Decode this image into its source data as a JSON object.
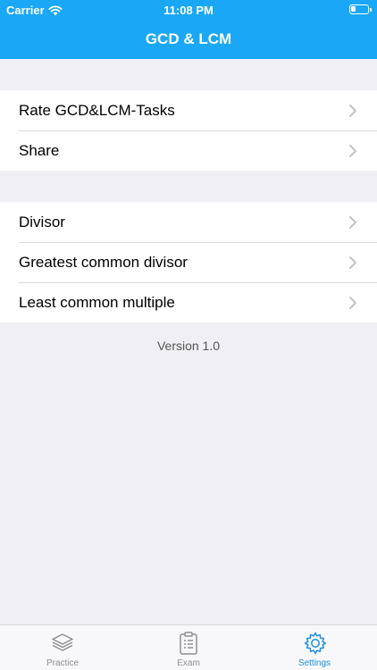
{
  "status_bar": {
    "carrier": "Carrier",
    "time": "11:08 PM",
    "battery_level": 0.3
  },
  "nav": {
    "title": "GCD & LCM"
  },
  "sections": [
    {
      "items": [
        {
          "label": "Rate GCD&LCM-Tasks"
        },
        {
          "label": "Share"
        }
      ]
    },
    {
      "items": [
        {
          "label": "Divisor"
        },
        {
          "label": "Greatest common divisor"
        },
        {
          "label": "Least common multiple"
        }
      ]
    }
  ],
  "footer": {
    "version": "Version 1.0"
  },
  "tabbar": {
    "tabs": [
      {
        "label": "Practice",
        "icon": "layers-icon"
      },
      {
        "label": "Exam",
        "icon": "clipboard-icon"
      },
      {
        "label": "Settings",
        "icon": "gear-icon"
      }
    ],
    "active": "Settings"
  },
  "colors": {
    "accent": "#1aa7f5",
    "tab_active": "#1a8fe0",
    "background": "#efeff4"
  }
}
